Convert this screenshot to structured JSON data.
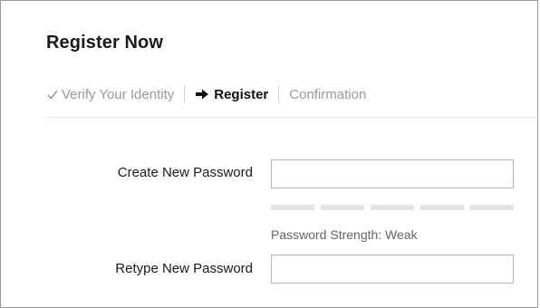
{
  "form": {
    "title": "Register Now"
  },
  "steps": [
    {
      "label": "Verify Your Identity",
      "state": "done",
      "icon": "check-icon"
    },
    {
      "label": "Register",
      "state": "current",
      "icon": "arrow-right-icon"
    },
    {
      "label": "Confirmation",
      "state": "upcoming"
    }
  ],
  "fields": {
    "new_password": {
      "label": "Create New Password",
      "value": "",
      "placeholder": ""
    },
    "retype_password": {
      "label": "Retype New Password",
      "value": "",
      "placeholder": ""
    }
  },
  "strength": {
    "segments_total": 5,
    "segments_filled": 0,
    "text": "Password Strength: Weak"
  },
  "colors": {
    "text": "#1a1a1a",
    "muted": "#9a9a9a",
    "strength_empty": "#e4e4e4"
  }
}
